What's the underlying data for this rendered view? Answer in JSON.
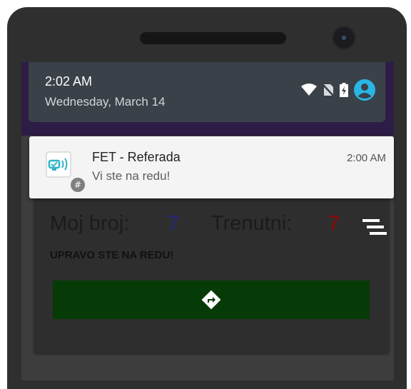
{
  "status_bar": {
    "time": "2:02 AM",
    "date": "Wednesday, March 14",
    "icons": [
      "wifi-icon",
      "no-sim-icon",
      "battery-icon",
      "account-icon"
    ],
    "accent": "#29b6e6"
  },
  "notification": {
    "app_name": "FET - Referada",
    "time": "2:00 AM",
    "text": "Vi ste na redu!",
    "badge_symbol": "#",
    "icon": "queue-ticket-icon"
  },
  "queue": {
    "my_label": "Moj broj:",
    "my_number": "7",
    "current_label": "Trenutni:",
    "current_number": "7",
    "status_text": "UPRAVO STE NA REDU!",
    "menu_icon": "queue-list-icon",
    "action_icon": "directions-icon"
  },
  "colors": {
    "my_number": "#27286a",
    "current_number": "#7a1010",
    "action_button": "#063a06"
  }
}
